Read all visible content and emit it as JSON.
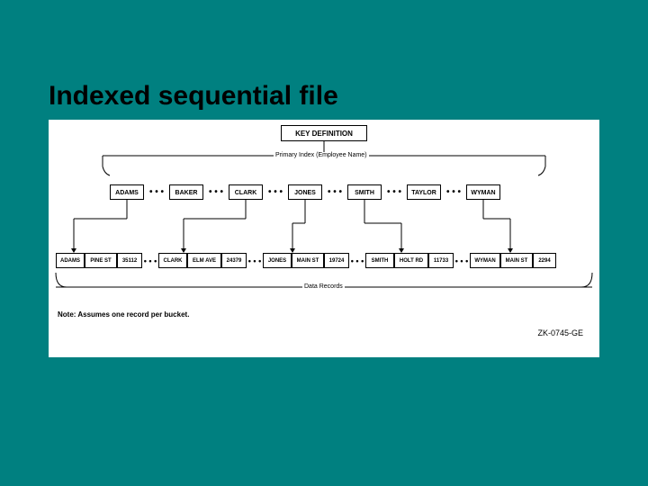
{
  "title": "Indexed sequential file",
  "diagram": {
    "key_definition": "KEY DEFINITION",
    "primary_index_label": "Primary Index (Employee Name)",
    "data_records_label": "Data Records",
    "index_entries": [
      "ADAMS",
      "BAKER",
      "CLARK",
      "JONES",
      "SMITH",
      "TAYLOR",
      "WYMAN"
    ],
    "data_records": [
      {
        "name": "ADAMS",
        "street": "PINE ST",
        "code": "35112"
      },
      {
        "name": "CLARK",
        "street": "ELM AVE",
        "code": "24379"
      },
      {
        "name": "JONES",
        "street": "MAIN ST",
        "code": "19724"
      },
      {
        "name": "SMITH",
        "street": "HOLT RD",
        "code": "11733"
      },
      {
        "name": "WYMAN",
        "street": "MAIN ST",
        "code": "2294"
      }
    ],
    "note": "Note: Assumes one record per bucket.",
    "ref": "ZK-0745-GE"
  }
}
